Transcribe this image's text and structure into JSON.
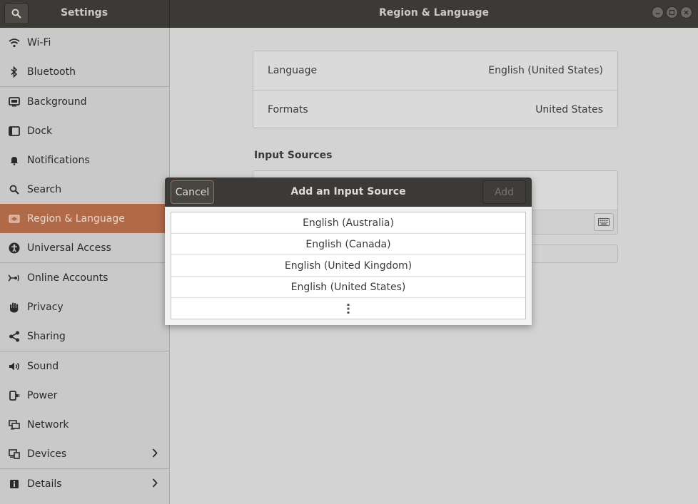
{
  "header": {
    "left_title": "Settings",
    "right_title": "Region & Language"
  },
  "sidebar": {
    "items": [
      {
        "label": "Wi-Fi",
        "icon": "wifi-icon"
      },
      {
        "label": "Bluetooth",
        "icon": "bluetooth-icon"
      },
      {
        "label": "Background",
        "icon": "background-icon"
      },
      {
        "label": "Dock",
        "icon": "dock-icon"
      },
      {
        "label": "Notifications",
        "icon": "bell-icon"
      },
      {
        "label": "Search",
        "icon": "search-icon"
      },
      {
        "label": "Region & Language",
        "icon": "flag-icon",
        "active": true
      },
      {
        "label": "Universal Access",
        "icon": "accessibility-icon"
      },
      {
        "label": "Online Accounts",
        "icon": "online-accounts-icon"
      },
      {
        "label": "Privacy",
        "icon": "hand-icon"
      },
      {
        "label": "Sharing",
        "icon": "share-icon"
      },
      {
        "label": "Sound",
        "icon": "speaker-icon"
      },
      {
        "label": "Power",
        "icon": "plug-icon"
      },
      {
        "label": "Network",
        "icon": "network-icon"
      },
      {
        "label": "Devices",
        "icon": "devices-icon"
      },
      {
        "label": "Details",
        "icon": "info-icon"
      }
    ]
  },
  "main": {
    "language_label": "Language",
    "language_value": "English (United States)",
    "formats_label": "Formats",
    "formats_value": "United States",
    "input_sources_title": "Input Sources"
  },
  "dialog": {
    "title": "Add an Input Source",
    "cancel_label": "Cancel",
    "add_label": "Add",
    "items": [
      "English (Australia)",
      "English (Canada)",
      "English (United Kingdom)",
      "English (United States)"
    ]
  },
  "colors": {
    "accent": "#b06a48",
    "headerbar": "#3b3a36"
  }
}
